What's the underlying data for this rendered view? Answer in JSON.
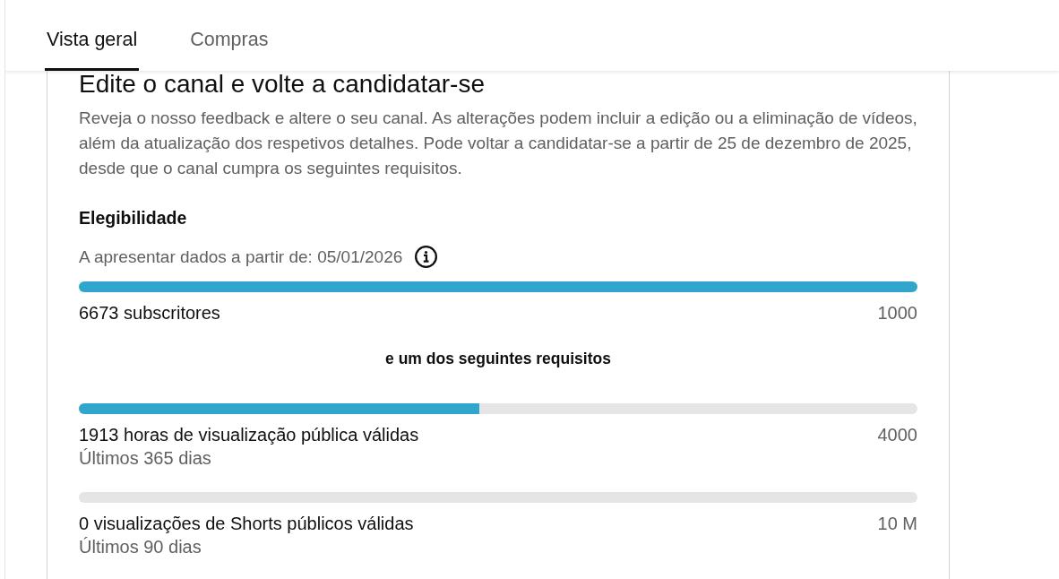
{
  "tabs": [
    {
      "label": "Vista geral",
      "selected": true
    },
    {
      "label": "Compras",
      "selected": false
    }
  ],
  "card": {
    "title": "Edite o canal e volte a candidatar-se",
    "description": "Reveja o nosso feedback e altere o seu canal. As alterações podem incluir a edição ou a eliminação de vídeos, além da atualização dos respetivos detalhes. Pode voltar a candidatar-se a partir de 25 de dezembro de 2025, desde que o canal cumpra os seguintes requisitos.",
    "section_title": "Elegibilidade",
    "data_note": "A apresentar dados a partir de: 05/01/2026",
    "primary_requirement": {
      "level": 1,
      "label": "6673 subscritores",
      "target": "1000"
    },
    "alternatives_label": "e um dos seguintes requisitos",
    "alternatives": [
      {
        "level": 0.478,
        "label": "1913 horas de visualização pública válidas",
        "target": "4000",
        "period": "Últimos 365 dias"
      },
      {
        "level": 0,
        "label": "0 visualizações de Shorts públicos válidas",
        "target": "10 M",
        "period": "Últimos 90 dias"
      }
    ]
  }
}
